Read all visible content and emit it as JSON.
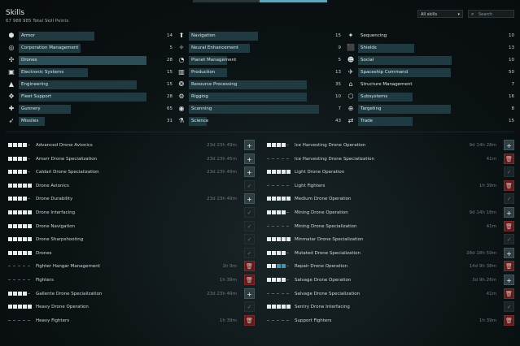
{
  "header": {
    "title": "Skills",
    "subtitle": "67 988 985 Total Skill Points",
    "filter_value": "All skills",
    "search_placeholder": "Search"
  },
  "categories": [
    {
      "label": "Armor",
      "count": "14",
      "icon": "armor-icon",
      "glyph": "⬢",
      "bar": 0.55
    },
    {
      "label": "Corporation Management",
      "count": "5",
      "icon": "corporation-icon",
      "glyph": "◎",
      "bar": 0.45
    },
    {
      "label": "Drones",
      "count": "28",
      "icon": "drones-icon",
      "glyph": "✣",
      "bar": 0.93,
      "selected": true
    },
    {
      "label": "Electronic Systems",
      "count": "15",
      "icon": "electronics-icon",
      "glyph": "▣",
      "bar": 0.5
    },
    {
      "label": "Engineering",
      "count": "15",
      "icon": "engineering-icon",
      "glyph": "▲",
      "bar": 0.86
    },
    {
      "label": "Fleet Support",
      "count": "28",
      "icon": "fleet-icon",
      "glyph": "✥",
      "bar": 0.93
    },
    {
      "label": "Gunnery",
      "count": "65",
      "icon": "gunnery-icon",
      "glyph": "✚",
      "bar": 0.38
    },
    {
      "label": "Missiles",
      "count": "31",
      "icon": "missiles-icon",
      "glyph": "➶",
      "bar": 0.19
    },
    {
      "label": "Navigation",
      "count": "15",
      "icon": "navigation-icon",
      "glyph": "⬆",
      "bar": 0.51
    },
    {
      "label": "Neural Enhancement",
      "count": "9",
      "icon": "neural-icon",
      "glyph": "✧",
      "bar": 0.45
    },
    {
      "label": "Planet Management",
      "count": "5",
      "icon": "planet-icon",
      "glyph": "◔",
      "bar": 0.28
    },
    {
      "label": "Production",
      "count": "13",
      "icon": "production-icon",
      "glyph": "▥",
      "bar": 0.28
    },
    {
      "label": "Resource Processing",
      "count": "35",
      "icon": "resource-icon",
      "glyph": "❂",
      "bar": 0.87
    },
    {
      "label": "Rigging",
      "count": "10",
      "icon": "rigging-icon",
      "glyph": "⚙",
      "bar": 0.87
    },
    {
      "label": "Scanning",
      "count": "7",
      "icon": "scanning-icon",
      "glyph": "◉",
      "bar": 0.96
    },
    {
      "label": "Science",
      "count": "43",
      "icon": "science-icon",
      "glyph": "⚗",
      "bar": 0.13
    },
    {
      "label": "Sequencing",
      "count": "10",
      "icon": "sequencing-icon",
      "glyph": "✦",
      "bar": 0.0
    },
    {
      "label": "Shields",
      "count": "13",
      "icon": "shields-icon",
      "glyph": "⬛",
      "bar": 0.4
    },
    {
      "label": "Social",
      "count": "10",
      "icon": "social-icon",
      "glyph": "☻",
      "bar": 0.67
    },
    {
      "label": "Spaceship Command",
      "count": "50",
      "icon": "spaceship-icon",
      "glyph": "✈",
      "bar": 0.66
    },
    {
      "label": "Structure Management",
      "count": "7",
      "icon": "structure-icon",
      "glyph": "⌂",
      "bar": 0.0
    },
    {
      "label": "Subsystems",
      "count": "16",
      "icon": "subsystems-icon",
      "glyph": "⬡",
      "bar": 0.39
    },
    {
      "label": "Targeting",
      "count": "8",
      "icon": "targeting-icon",
      "glyph": "⊕",
      "bar": 0.66
    },
    {
      "label": "Trade",
      "count": "15",
      "icon": "trade-icon",
      "glyph": "⇄",
      "bar": 0.39
    }
  ],
  "skills_left": [
    {
      "name": "Advanced Drone Avionics",
      "level": 4,
      "queued": 0,
      "time": "23d 23h 49m",
      "action": "add"
    },
    {
      "name": "Amarr Drone Specialization",
      "level": 4,
      "queued": 0,
      "time": "23d 23h 45m",
      "action": "add"
    },
    {
      "name": "Caldari Drone Specialization",
      "level": 4,
      "queued": 0,
      "time": "23d 23h 49m",
      "action": "add"
    },
    {
      "name": "Drone Avionics",
      "level": 5,
      "queued": 0,
      "time": "",
      "action": "done"
    },
    {
      "name": "Drone Durability",
      "level": 4,
      "queued": 0,
      "time": "23d 23h 49m",
      "action": "add"
    },
    {
      "name": "Drone Interfacing",
      "level": 5,
      "queued": 0,
      "time": "",
      "action": "done"
    },
    {
      "name": "Drone Navigation",
      "level": 5,
      "queued": 0,
      "time": "",
      "action": "done"
    },
    {
      "name": "Drone Sharpshooting",
      "level": 5,
      "queued": 0,
      "time": "",
      "action": "done"
    },
    {
      "name": "Drones",
      "level": 5,
      "queued": 0,
      "time": "",
      "action": "done"
    },
    {
      "name": "Fighter Hangar Management",
      "level": 0,
      "queued": 0,
      "time": "1h 9m",
      "action": "remove"
    },
    {
      "name": "Fighters",
      "level": 0,
      "queued": 0,
      "time": "1h 39m",
      "action": "remove"
    },
    {
      "name": "Gallente Drone Specialization",
      "level": 4,
      "queued": 0,
      "time": "23d 23h 49m",
      "action": "add"
    },
    {
      "name": "Heavy Drone Operation",
      "level": 5,
      "queued": 0,
      "time": "",
      "action": "done"
    },
    {
      "name": "Heavy Fighters",
      "level": 0,
      "queued": 0,
      "time": "1h 39m",
      "action": "remove"
    }
  ],
  "skills_right": [
    {
      "name": "Ice Harvesting Drone Operation",
      "level": 4,
      "queued": 0,
      "time": "9d 14h 28m",
      "action": "add"
    },
    {
      "name": "Ice Harvesting Drone Specialization",
      "level": 0,
      "queued": 0,
      "time": "41m",
      "action": "remove"
    },
    {
      "name": "Light Drone Operation",
      "level": 5,
      "queued": 0,
      "time": "",
      "action": "done"
    },
    {
      "name": "Light Fighters",
      "level": 0,
      "queued": 0,
      "time": "1h 39m",
      "action": "remove"
    },
    {
      "name": "Medium Drone Operation",
      "level": 5,
      "queued": 0,
      "time": "",
      "action": "done"
    },
    {
      "name": "Mining Drone Operation",
      "level": 4,
      "queued": 0,
      "time": "9d 14h 18m",
      "action": "add"
    },
    {
      "name": "Mining Drone Specialization",
      "level": 0,
      "queued": 0,
      "time": "41m",
      "action": "remove"
    },
    {
      "name": "Minmatar Drone Specialization",
      "level": 5,
      "queued": 0,
      "time": "",
      "action": "done"
    },
    {
      "name": "Mutated Drone Specialization",
      "level": 4,
      "queued": 0,
      "time": "28d 18h 59m",
      "action": "add"
    },
    {
      "name": "Repair Drone Operation",
      "level": 2,
      "queued": 2,
      "time": "14d 9h 38m",
      "action": "remove"
    },
    {
      "name": "Salvage Drone Operation",
      "level": 4,
      "queued": 0,
      "time": "3d 9h 26m",
      "action": "add"
    },
    {
      "name": "Salvage Drone Specialization",
      "level": 0,
      "queued": 0,
      "time": "41m",
      "action": "remove"
    },
    {
      "name": "Sentry Drone Interfacing",
      "level": 5,
      "queued": 0,
      "time": "",
      "action": "done"
    },
    {
      "name": "Support Fighters",
      "level": 0,
      "queued": 0,
      "time": "1h 39m",
      "action": "remove"
    }
  ],
  "action_glyphs": {
    "add": "+",
    "remove": "🗑",
    "done": "✓"
  }
}
